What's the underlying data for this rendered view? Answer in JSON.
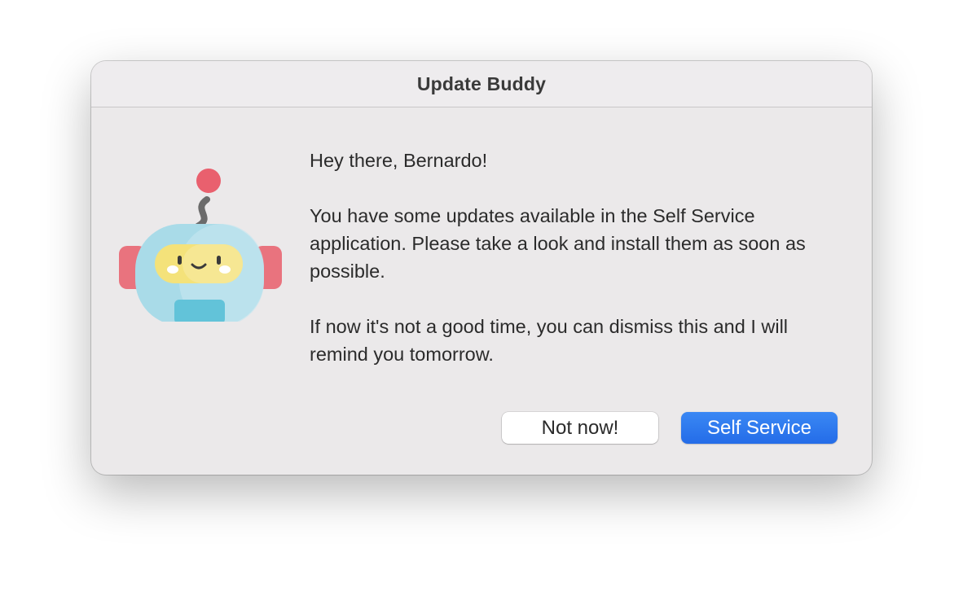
{
  "window": {
    "title": "Update Buddy"
  },
  "mascot": {
    "icon": "robot-mascot-icon"
  },
  "message": {
    "greeting": "Hey there, Bernardo!",
    "body": "You have some updates available in the Self Service application. Please take a look and install them as soon as possible.",
    "footer": "If now it's not a good time, you can dismiss this and I will remind you tomorrow."
  },
  "buttons": {
    "dismiss_label": "Not now!",
    "primary_label": "Self Service"
  },
  "colors": {
    "primary": "#2a74eb",
    "window_bg": "#ebe9ea",
    "robot_head": "#a9dbe8",
    "robot_visor": "#f4e27a",
    "robot_ears": "#e9737e",
    "antenna_ball": "#e9606e"
  }
}
